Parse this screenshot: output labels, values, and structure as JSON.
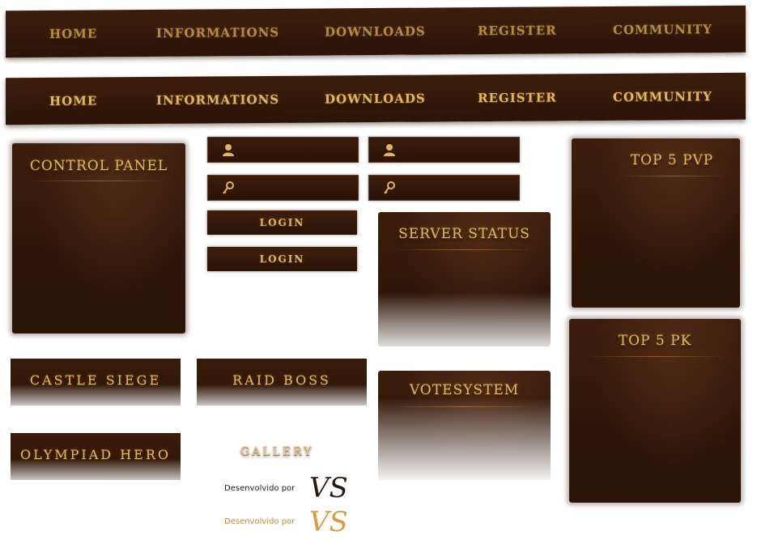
{
  "nav": {
    "items": [
      "HOME",
      "INFORMATIONS",
      "DOWNLOADS",
      "REGISTER",
      "COMMUNITY"
    ]
  },
  "panels": {
    "control_panel": "CONTROL PANEL",
    "top_pvp": "TOP 5 PVP",
    "server_status": "SERVER STATUS",
    "top_pk": "TOP 5 PK",
    "votesystem": "VOTESYSTEM",
    "castle_siege": "CASTLE SIEGE",
    "raid_boss": "RAID BOSS",
    "olympiad_hero": "OLYMPIAD HERO",
    "gallery": "GALLERY"
  },
  "login": {
    "button_label": "LOGIN"
  },
  "credit": {
    "text": "Desenvolvido por",
    "logo": "VS"
  },
  "colors": {
    "panel": "#2f1608",
    "gold": "#e4b65c"
  }
}
